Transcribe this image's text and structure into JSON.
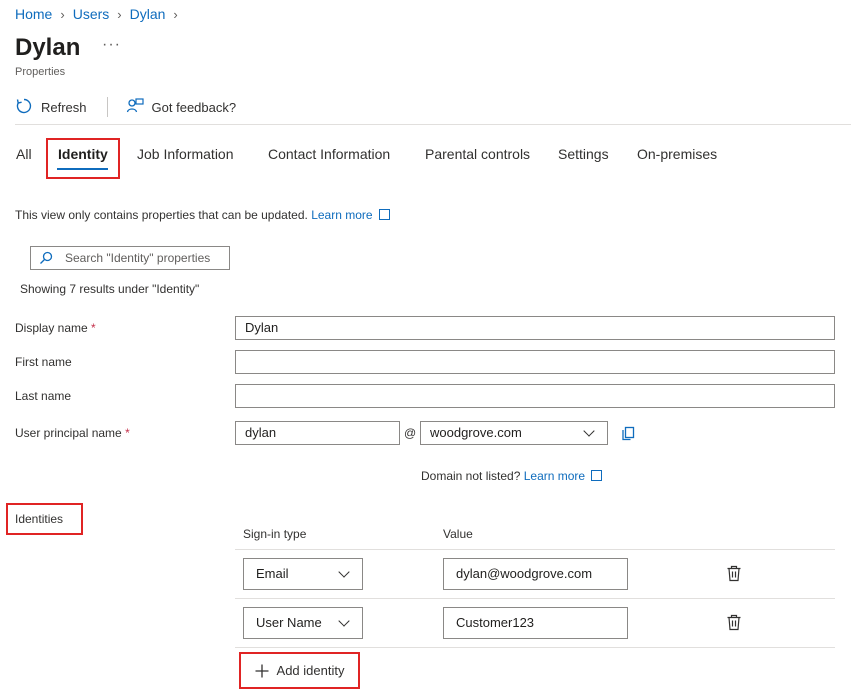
{
  "breadcrumb": {
    "items": [
      "Home",
      "Users",
      "Dylan"
    ]
  },
  "page": {
    "title": "Dylan",
    "subtitle": "Properties",
    "more": "···"
  },
  "toolbar": {
    "refresh": "Refresh",
    "feedback": "Got feedback?"
  },
  "tabs": [
    "All",
    "Identity",
    "Job Information",
    "Contact Information",
    "Parental controls",
    "Settings",
    "On-premises"
  ],
  "active_tab": "Identity",
  "info": {
    "text": "This view only contains properties that can be updated.",
    "link": "Learn more"
  },
  "search": {
    "placeholder": "Search \"Identity\" properties"
  },
  "results_text": "Showing 7 results under \"Identity\"",
  "fields": {
    "display_name": {
      "label": "Display name",
      "required": "*",
      "value": "Dylan"
    },
    "first_name": {
      "label": "First name",
      "value": ""
    },
    "last_name": {
      "label": "Last name",
      "value": ""
    },
    "upn": {
      "label": "User principal name",
      "required": "*",
      "value": "dylan",
      "at": "@",
      "domain": "woodgrove.com"
    }
  },
  "domain_note": {
    "text": "Domain not listed?",
    "link": "Learn more"
  },
  "identities": {
    "label": "Identities",
    "col_signin": "Sign-in type",
    "col_value": "Value",
    "rows": [
      {
        "type": "Email",
        "value": "dylan@woodgrove.com"
      },
      {
        "type": "User Name",
        "value": "Customer123"
      }
    ],
    "add_label": "Add identity"
  },
  "colors": {
    "link": "#0f6cbd",
    "highlight": "#e02424",
    "required": "#c4314b"
  },
  "icons": [
    "chevron-right-icon",
    "refresh-icon",
    "feedback-icon",
    "external-link-icon",
    "search-icon",
    "copy-icon",
    "chevron-down-icon",
    "trash-icon",
    "plus-icon"
  ]
}
